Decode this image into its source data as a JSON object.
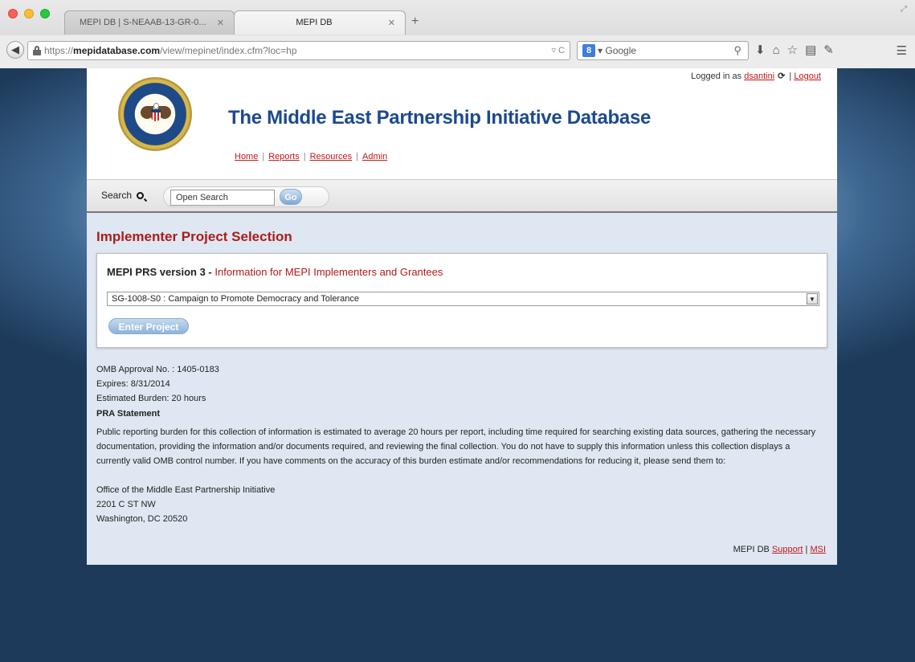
{
  "browser": {
    "tabs": [
      {
        "title": "MEPI DB | S-NEAAB-13-GR-0...",
        "active": false
      },
      {
        "title": "MEPI DB",
        "active": true
      }
    ],
    "url_prefix": "https://",
    "url_domain": "mepidatabase.com",
    "url_path": "/view/mepinet/index.cfm?loc=hp",
    "search_engine": "Google"
  },
  "site": {
    "title": "The Middle East Partnership Initiative Database",
    "nav": [
      {
        "label": "Home"
      },
      {
        "label": "Reports"
      },
      {
        "label": "Resources"
      },
      {
        "label": "Admin"
      }
    ],
    "login_prefix": "Logged in as",
    "username": "dsantini",
    "logout_label": "Logout",
    "search": {
      "label": "Search",
      "value": "Open Search",
      "go_label": "Go"
    }
  },
  "main": {
    "heading": "Implementer Project Selection",
    "panel_title_bold": "MEPI PRS version 3 -",
    "panel_title_rest": "Information for MEPI Implementers and Grantees",
    "selected_project": "SG-1008-S0 : Campaign to Promote Democracy and Tolerance",
    "enter_button": "Enter Project",
    "omb": [
      "OMB Approval No. : 1405-0183",
      "Expires: 8/31/2014",
      "Estimated Burden: 20 hours"
    ],
    "pra_heading": "PRA Statement",
    "pra_text": "Public reporting burden for this collection of information is estimated to average 20 hours per report, including time required for searching existing data sources, gathering the necessary documentation, providing the information and/or documents required, and reviewing the final collection. You do not have to supply this information unless this collection displays a currently valid OMB control number. If you have comments on the accuracy of this burden estimate and/or recommendations for reducing it, please send them to:",
    "address": [
      "Office of the Middle East Partnership Initiative",
      "2201 C ST NW",
      "Washington, DC 20520"
    ]
  },
  "footer": {
    "prefix": "MEPI DB",
    "support_label": "Support",
    "msi_label": "MSI"
  }
}
